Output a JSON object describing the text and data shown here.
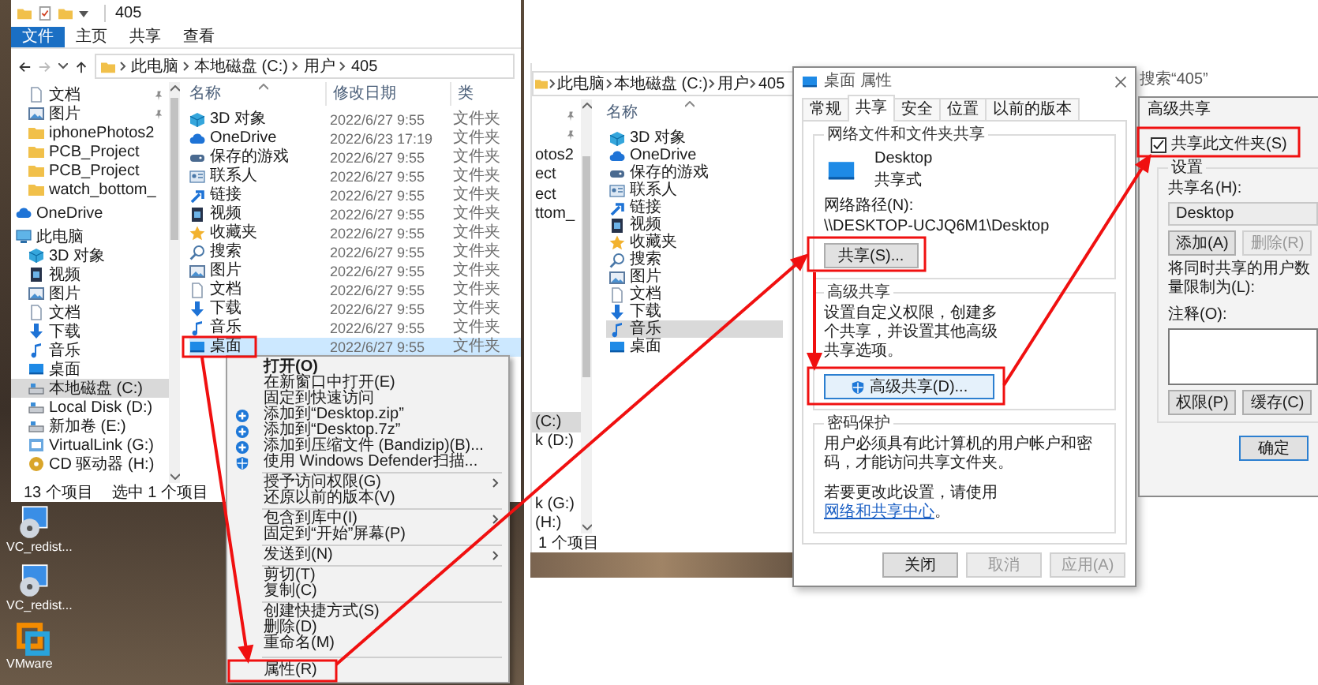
{
  "left_window": {
    "title": "405",
    "ribbon_tabs": [
      {
        "label": "文件",
        "selected": true
      },
      {
        "label": "主页",
        "selected": false
      },
      {
        "label": "共享",
        "selected": false
      },
      {
        "label": "查看",
        "selected": false
      }
    ],
    "address": [
      "此电脑",
      "本地磁盘 (C:)",
      "用户",
      "405"
    ],
    "nav": [
      {
        "children": [
          {
            "label": "文档",
            "kind": "doc",
            "pinned": true,
            "selected": false
          },
          {
            "label": "图片",
            "kind": "image",
            "pinned": true,
            "selected": false
          },
          {
            "label": "iphonePhotos2",
            "kind": "folder",
            "pinned": false,
            "selected": false
          },
          {
            "label": "PCB_Project",
            "kind": "folder",
            "pinned": false,
            "selected": false
          },
          {
            "label": "PCB_Project",
            "kind": "folder",
            "pinned": false,
            "selected": false
          },
          {
            "label": "watch_bottom_",
            "kind": "folder",
            "pinned": false,
            "selected": false
          }
        ]
      },
      {
        "label": "OneDrive",
        "kind": "cloud",
        "pinned": false,
        "selected": false
      },
      {
        "label": "此电脑",
        "kind": "pc",
        "pinned": false,
        "selected": false,
        "children": [
          {
            "label": "3D 对象",
            "kind": "cube",
            "pinned": false,
            "selected": false
          },
          {
            "label": "视频",
            "kind": "video",
            "pinned": false,
            "selected": false
          },
          {
            "label": "图片",
            "kind": "image",
            "pinned": false,
            "selected": false
          },
          {
            "label": "文档",
            "kind": "doc",
            "pinned": false,
            "selected": false
          },
          {
            "label": "下载",
            "kind": "download",
            "pinned": false,
            "selected": false
          },
          {
            "label": "音乐",
            "kind": "music",
            "pinned": false,
            "selected": false
          },
          {
            "label": "桌面",
            "kind": "desktop",
            "pinned": false,
            "selected": false
          },
          {
            "label": "本地磁盘 (C:)",
            "kind": "drive",
            "pinned": false,
            "selected": true
          },
          {
            "label": "Local Disk (D:)",
            "kind": "drive",
            "pinned": false,
            "selected": false
          },
          {
            "label": "新加卷 (E:)",
            "kind": "drive",
            "pinned": false,
            "selected": false
          },
          {
            "label": "VirtualLink (G:)",
            "kind": "netdrive",
            "pinned": false,
            "selected": false
          },
          {
            "label": "CD 驱动器 (H:)",
            "kind": "disc",
            "pinned": false,
            "selected": false
          }
        ]
      }
    ],
    "columns": [
      "名称",
      "修改日期",
      "类"
    ],
    "rows": [
      {
        "name": "3D 对象",
        "kind": "cube",
        "date": "2022/6/27 9:55",
        "type": "文件夹",
        "selected": false
      },
      {
        "name": "OneDrive",
        "kind": "cloud",
        "date": "2022/6/23 17:19",
        "type": "文件夹",
        "selected": false
      },
      {
        "name": "保存的游戏",
        "kind": "game",
        "date": "2022/6/27 9:55",
        "type": "文件夹",
        "selected": false
      },
      {
        "name": "联系人",
        "kind": "contact",
        "date": "2022/6/27 9:55",
        "type": "文件夹",
        "selected": false
      },
      {
        "name": "链接",
        "kind": "link",
        "date": "2022/6/27 9:55",
        "type": "文件夹",
        "selected": false
      },
      {
        "name": "视频",
        "kind": "video",
        "date": "2022/6/27 9:55",
        "type": "文件夹",
        "selected": false
      },
      {
        "name": "收藏夹",
        "kind": "star",
        "date": "2022/6/27 9:55",
        "type": "文件夹",
        "selected": false
      },
      {
        "name": "搜索",
        "kind": "search",
        "date": "2022/6/27 9:55",
        "type": "文件夹",
        "selected": false
      },
      {
        "name": "图片",
        "kind": "image",
        "date": "2022/6/27 9:55",
        "type": "文件夹",
        "selected": false
      },
      {
        "name": "文档",
        "kind": "doc",
        "date": "2022/6/27 9:55",
        "type": "文件夹",
        "selected": false
      },
      {
        "name": "下载",
        "kind": "download",
        "date": "2022/6/27 9:55",
        "type": "文件夹",
        "selected": false
      },
      {
        "name": "音乐",
        "kind": "music",
        "date": "2022/6/27 9:55",
        "type": "文件夹",
        "selected": false
      },
      {
        "name": "桌面",
        "kind": "desktop",
        "date": "2022/6/27 9:55",
        "type": "文件夹",
        "selected": true
      }
    ],
    "status": [
      "13 个项目",
      "选中 1 个项目"
    ]
  },
  "desktop_icons": [
    {
      "label": "VC_redist...",
      "kind": "installer"
    },
    {
      "label": "VC_redist...",
      "kind": "installer"
    },
    {
      "label": "VMware",
      "kind": "vmware"
    }
  ],
  "context_menu": [
    {
      "kind": "default",
      "label": "打开(O)",
      "submenu": false
    },
    {
      "kind": "item",
      "label": "在新窗口中打开(E)",
      "submenu": false
    },
    {
      "kind": "item",
      "label": "固定到快速访问",
      "submenu": false
    },
    {
      "kind": "archive",
      "label": "添加到“Desktop.zip”",
      "submenu": false
    },
    {
      "kind": "archive",
      "label": "添加到“Desktop.7z”",
      "submenu": false
    },
    {
      "kind": "archive",
      "label": "添加到压缩文件 (Bandizip)(B)...",
      "submenu": false
    },
    {
      "kind": "scan",
      "label": "使用 Windows Defender扫描...",
      "submenu": false
    },
    {
      "kind": "separator"
    },
    {
      "kind": "item",
      "label": "授予访问权限(G)",
      "submenu": true
    },
    {
      "kind": "item",
      "label": "还原以前的版本(V)",
      "submenu": false
    },
    {
      "kind": "separator"
    },
    {
      "kind": "item",
      "label": "包含到库中(I)",
      "submenu": true
    },
    {
      "kind": "item",
      "label": "固定到“开始”屏幕(P)",
      "submenu": false
    },
    {
      "kind": "separator"
    },
    {
      "kind": "item",
      "label": "发送到(N)",
      "submenu": true
    },
    {
      "kind": "separator"
    },
    {
      "kind": "item",
      "label": "剪切(T)",
      "submenu": false
    },
    {
      "kind": "item",
      "label": "复制(C)",
      "submenu": false
    },
    {
      "kind": "separator"
    },
    {
      "kind": "item",
      "label": "创建快捷方式(S)",
      "submenu": false
    },
    {
      "kind": "item",
      "label": "删除(D)",
      "submenu": false
    },
    {
      "kind": "item",
      "label": "重命名(M)",
      "submenu": false
    },
    {
      "kind": "separator"
    },
    {
      "kind": "item",
      "label": "属性(R)",
      "submenu": false
    }
  ],
  "right_window": {
    "address": [
      "此电脑",
      "本地磁盘 (C:)",
      "用户",
      "405"
    ],
    "nav_top": [
      {
        "pinned": true
      },
      {
        "pinned": true
      },
      {
        "label": "otos2",
        "pinned": false
      },
      {
        "label": "ect",
        "pinned": false
      },
      {
        "label": "ect",
        "pinned": false
      },
      {
        "label": "ttom_",
        "pinned": false
      }
    ],
    "nav_bottom": [
      {
        "label": "(C:)",
        "selected": true
      },
      {
        "label": "k (D:)",
        "selected": false
      },
      {
        "label": "k (G:)",
        "selected": false
      },
      {
        "label": "(H:)",
        "selected": false
      }
    ],
    "column": "名称",
    "rows": [
      {
        "name": "3D 对象",
        "kind": "cube",
        "selected": false
      },
      {
        "name": "OneDrive",
        "kind": "cloud",
        "selected": false
      },
      {
        "name": "保存的游戏",
        "kind": "game",
        "selected": false
      },
      {
        "name": "联系人",
        "kind": "contact",
        "selected": false
      },
      {
        "name": "链接",
        "kind": "link",
        "selected": false
      },
      {
        "name": "视频",
        "kind": "video",
        "selected": false
      },
      {
        "name": "收藏夹",
        "kind": "star",
        "selected": false
      },
      {
        "name": "搜索",
        "kind": "search",
        "selected": false
      },
      {
        "name": "图片",
        "kind": "image",
        "selected": false
      },
      {
        "name": "文档",
        "kind": "doc",
        "selected": false
      },
      {
        "name": "下载",
        "kind": "download",
        "selected": false
      },
      {
        "name": "音乐",
        "kind": "music",
        "selected": true
      },
      {
        "name": "桌面",
        "kind": "desktop",
        "selected": false
      }
    ],
    "status": "1 个项目"
  },
  "properties": {
    "title": "桌面 属性",
    "tabs": [
      {
        "label": "常规",
        "selected": false
      },
      {
        "label": "共享",
        "selected": true
      },
      {
        "label": "安全",
        "selected": false
      },
      {
        "label": "位置",
        "selected": false
      },
      {
        "label": "以前的版本",
        "selected": false
      }
    ],
    "share_group": {
      "title": "网络文件和文件夹共享",
      "name": "Desktop",
      "state": "共享式",
      "path_label": "网络路径(N):",
      "path": "\\\\DESKTOP-UCJQ6M1\\Desktop",
      "button": "共享(S)..."
    },
    "advanced_group": {
      "title": "高级共享",
      "text": "设置自定义权限，创建多个共享，并设置其他高级共享选项。",
      "button": "高级共享(D)..."
    },
    "password_group": {
      "title": "密码保护",
      "text": "用户必须具有此计算机的用户帐户和密码，才能访问共享文件夹。",
      "hint": "若要更改此设置，请使用",
      "link": "网络和共享中心",
      "hint_end": "。"
    },
    "buttons": [
      {
        "label": "关闭",
        "disabled": false
      },
      {
        "label": "取消",
        "disabled": true
      },
      {
        "label": "应用(A)",
        "disabled": true
      }
    ]
  },
  "advanced_sharing": {
    "search_label": "搜索“405”",
    "title": "高级共享",
    "share": {
      "label": "共享此文件夹(S)",
      "checked": true
    },
    "group_title": "设置",
    "share_name_label": "共享名(H):",
    "share_name": "Desktop",
    "name_buttons": [
      {
        "label": "添加(A)",
        "disabled": false
      },
      {
        "label": "删除(R)",
        "disabled": true
      }
    ],
    "limit_label": "将同时共享的用户数量限制为(L):",
    "comment_label": "注释(O):",
    "lower_buttons": [
      {
        "label": "权限(P)",
        "disabled": false
      },
      {
        "label": "缓存(C)",
        "disabled": false
      }
    ],
    "ok": "确定"
  }
}
